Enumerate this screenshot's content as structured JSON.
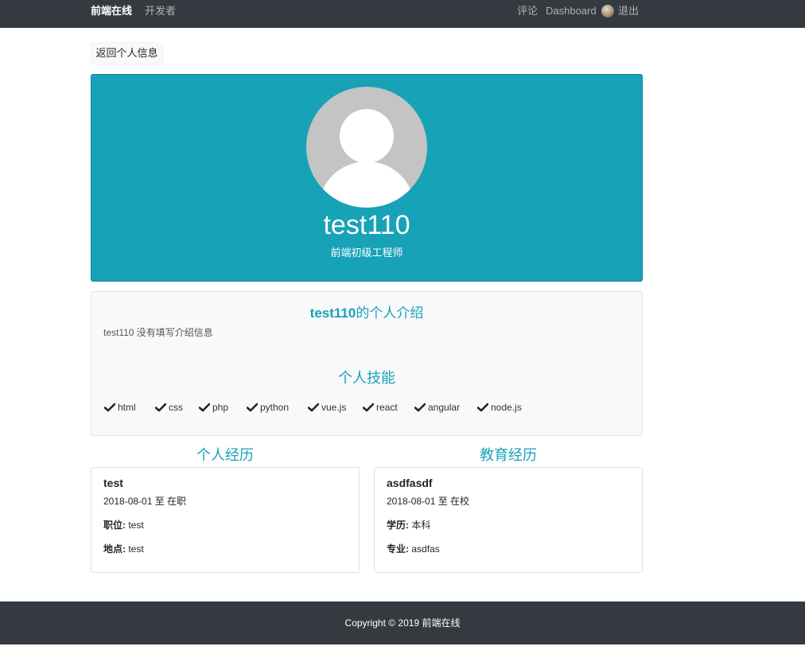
{
  "navbar": {
    "brand": "前端在线",
    "developers": "开发者",
    "comments": "评论",
    "dashboard": "Dashboard",
    "logout": "退出"
  },
  "back_button": "返回个人信息",
  "profile": {
    "name": "test110",
    "title": "前端初级工程师"
  },
  "about": {
    "heading_name": "test110",
    "heading_suffix": "的个人介绍",
    "text": "test110 没有填写介绍信息",
    "skills_heading": "个人技能",
    "skills": [
      "html",
      "css",
      "php",
      "python",
      "vue.js",
      "react",
      "angular",
      "node.js"
    ]
  },
  "experience": {
    "heading": "个人经历",
    "title": "test",
    "dates": "2018-08-01 至 在职",
    "position_label": "职位:",
    "position_value": "test",
    "location_label": "地点:",
    "location_value": "test"
  },
  "education": {
    "heading": "教育经历",
    "school": "asdfasdf",
    "dates": "2018-08-01 至 在校",
    "degree_label": "学历:",
    "degree_value": "本科",
    "major_label": "专业:",
    "major_value": "asdfas"
  },
  "footer": "Copyright © 2019 前端在线",
  "colors": {
    "accent": "#17a2b8",
    "navbar_bg": "#343a40",
    "card_bg": "#f8f9fa"
  }
}
